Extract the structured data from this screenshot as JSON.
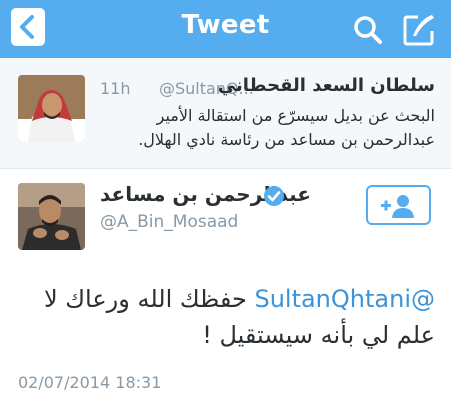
{
  "nav": {
    "title": "Tweet"
  },
  "parent_tweet": {
    "name": "سلطان السعد القحطاني",
    "handle": "@SultanQ...",
    "time": "11h",
    "text": "البحث عن بديل سيسرّع من استقالة الأمير عبدالرحمن بن مساعد من رئاسة نادي الهلال."
  },
  "main_tweet": {
    "name": "عبدالرحمن بن مساعد",
    "handle": "@A_Bin_Mosaad",
    "mention": "@SultanQhtani",
    "text": "حفظك الله ورعاك لا علم لي بأنه سيستقيل !",
    "timestamp": "02/07/2014 18:31"
  },
  "icons": {
    "back": "chevron-left-icon",
    "search": "search-icon",
    "compose": "compose-icon",
    "verified": "verified-badge-icon",
    "follow": "follow-user-icon"
  },
  "colors": {
    "brand": "#55acee",
    "link": "#3b94d9",
    "text": "#292f33",
    "muted": "#8899a6"
  }
}
